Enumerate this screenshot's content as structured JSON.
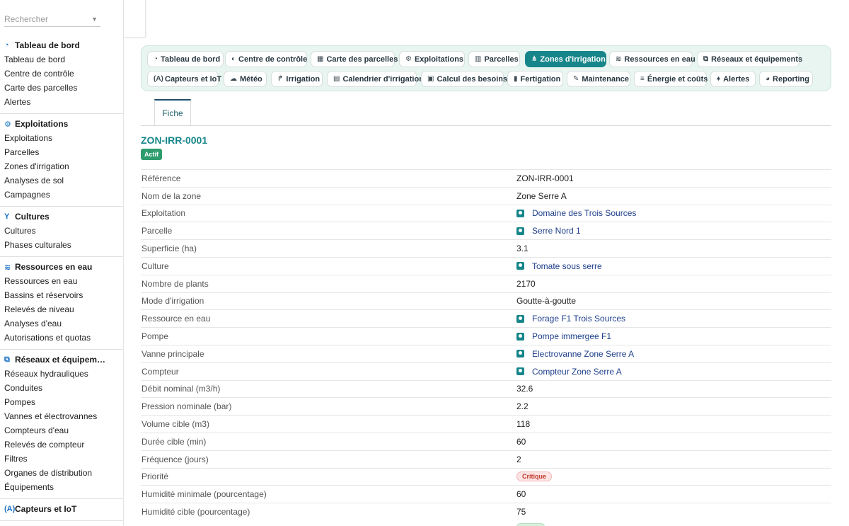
{
  "sidebar": {
    "search_placeholder": "Rechercher",
    "groups": [
      {
        "title": "Tableau de bord",
        "icon": "gauge-icon",
        "items": [
          "Tableau de bord",
          "Centre de contrôle",
          "Carte des parcelles",
          "Alertes"
        ]
      },
      {
        "title": "Exploitations",
        "icon": "tractor-icon",
        "items": [
          "Exploitations",
          "Parcelles",
          "Zones d'irrigation",
          "Analyses de sol",
          "Campagnes"
        ]
      },
      {
        "title": "Cultures",
        "icon": "seedling-icon",
        "items": [
          "Cultures",
          "Phases culturales"
        ]
      },
      {
        "title": "Ressources en eau",
        "icon": "water-icon",
        "items": [
          "Ressources en eau",
          "Bassins et réservoirs",
          "Relevés de niveau",
          "Analyses d'eau",
          "Autorisations et quotas"
        ]
      },
      {
        "title": "Réseaux et équipem…",
        "icon": "network-icon",
        "items": [
          "Réseaux hydrauliques",
          "Conduites",
          "Pompes",
          "Vannes et électrovannes",
          "Compteurs d'eau",
          "Relevés de compteur",
          "Filtres",
          "Organes de distribution",
          "Équipements"
        ]
      },
      {
        "title": "Capteurs et IoT",
        "icon": "sensor-icon",
        "items": []
      }
    ]
  },
  "tabs": [
    {
      "label": "Tableau de bord",
      "icon": "gauge-icon",
      "active": false
    },
    {
      "label": "Centre de contrôle",
      "icon": "control-icon",
      "active": false
    },
    {
      "label": "Carte des parcelles",
      "icon": "map-icon",
      "active": false
    },
    {
      "label": "Exploitations",
      "icon": "tractor-icon",
      "active": false
    },
    {
      "label": "Parcelles",
      "icon": "parcel-icon",
      "active": false
    },
    {
      "label": "Zones d'irrigation",
      "icon": "sitemap-icon",
      "active": true
    },
    {
      "label": "Ressources en eau",
      "icon": "water-icon",
      "active": false
    },
    {
      "label": "Réseaux et équipements",
      "icon": "network-icon",
      "active": false
    },
    {
      "label": "Capteurs et IoT",
      "icon": "sensor-icon",
      "active": false
    },
    {
      "label": "Météo",
      "icon": "weather-icon",
      "active": false
    },
    {
      "label": "Irrigation",
      "icon": "irrigation-icon",
      "active": false
    },
    {
      "label": "Calendrier d'irrigation",
      "icon": "calendar-icon",
      "active": false
    },
    {
      "label": "Calcul des besoins",
      "icon": "calculator-icon",
      "active": false
    },
    {
      "label": "Fertigation",
      "icon": "fertigation-icon",
      "active": false
    },
    {
      "label": "Maintenance",
      "icon": "wrench-icon",
      "active": false
    },
    {
      "label": "Énergie et coûts",
      "icon": "coins-icon",
      "active": false
    },
    {
      "label": "Alertes",
      "icon": "bell-icon",
      "active": false
    },
    {
      "label": "Reporting",
      "icon": "chart-pie-icon",
      "active": false
    }
  ],
  "subtab": "Fiche",
  "record": {
    "title": "ZON-IRR-0001",
    "status": "Actif",
    "fields": [
      {
        "label": "Référence",
        "value": "ZON-IRR-0001",
        "kind": "text"
      },
      {
        "label": "Nom de la zone",
        "value": "Zone Serre A",
        "kind": "text"
      },
      {
        "label": "Exploitation",
        "value": "Domaine des Trois Sources",
        "kind": "link"
      },
      {
        "label": "Parcelle",
        "value": "Serre Nord 1",
        "kind": "link"
      },
      {
        "label": "Superficie (ha)",
        "value": "3.1",
        "kind": "text"
      },
      {
        "label": "Culture",
        "value": "Tomate sous serre",
        "kind": "link"
      },
      {
        "label": "Nombre de plants",
        "value": "2170",
        "kind": "text"
      },
      {
        "label": "Mode d'irrigation",
        "value": "Goutte-à-goutte",
        "kind": "text"
      },
      {
        "label": "Ressource en eau",
        "value": "Forage F1 Trois Sources",
        "kind": "link"
      },
      {
        "label": "Pompe",
        "value": "Pompe immergee F1",
        "kind": "link"
      },
      {
        "label": "Vanne principale",
        "value": "Electrovanne Zone Serre A",
        "kind": "link"
      },
      {
        "label": "Compteur",
        "value": "Compteur Zone Serre A",
        "kind": "link"
      },
      {
        "label": "Débit nominal (m3/h)",
        "value": "32.6",
        "kind": "text"
      },
      {
        "label": "Pression nominale (bar)",
        "value": "2.2",
        "kind": "text"
      },
      {
        "label": "Volume cible (m3)",
        "value": "118",
        "kind": "text"
      },
      {
        "label": "Durée cible (min)",
        "value": "60",
        "kind": "text"
      },
      {
        "label": "Fréquence (jours)",
        "value": "2",
        "kind": "text"
      },
      {
        "label": "Priorité",
        "value": "Critique",
        "kind": "badge"
      },
      {
        "label": "Humidité minimale (pourcentage)",
        "value": "60",
        "kind": "text"
      },
      {
        "label": "Humidité cible (pourcentage)",
        "value": "75",
        "kind": "text"
      }
    ]
  }
}
